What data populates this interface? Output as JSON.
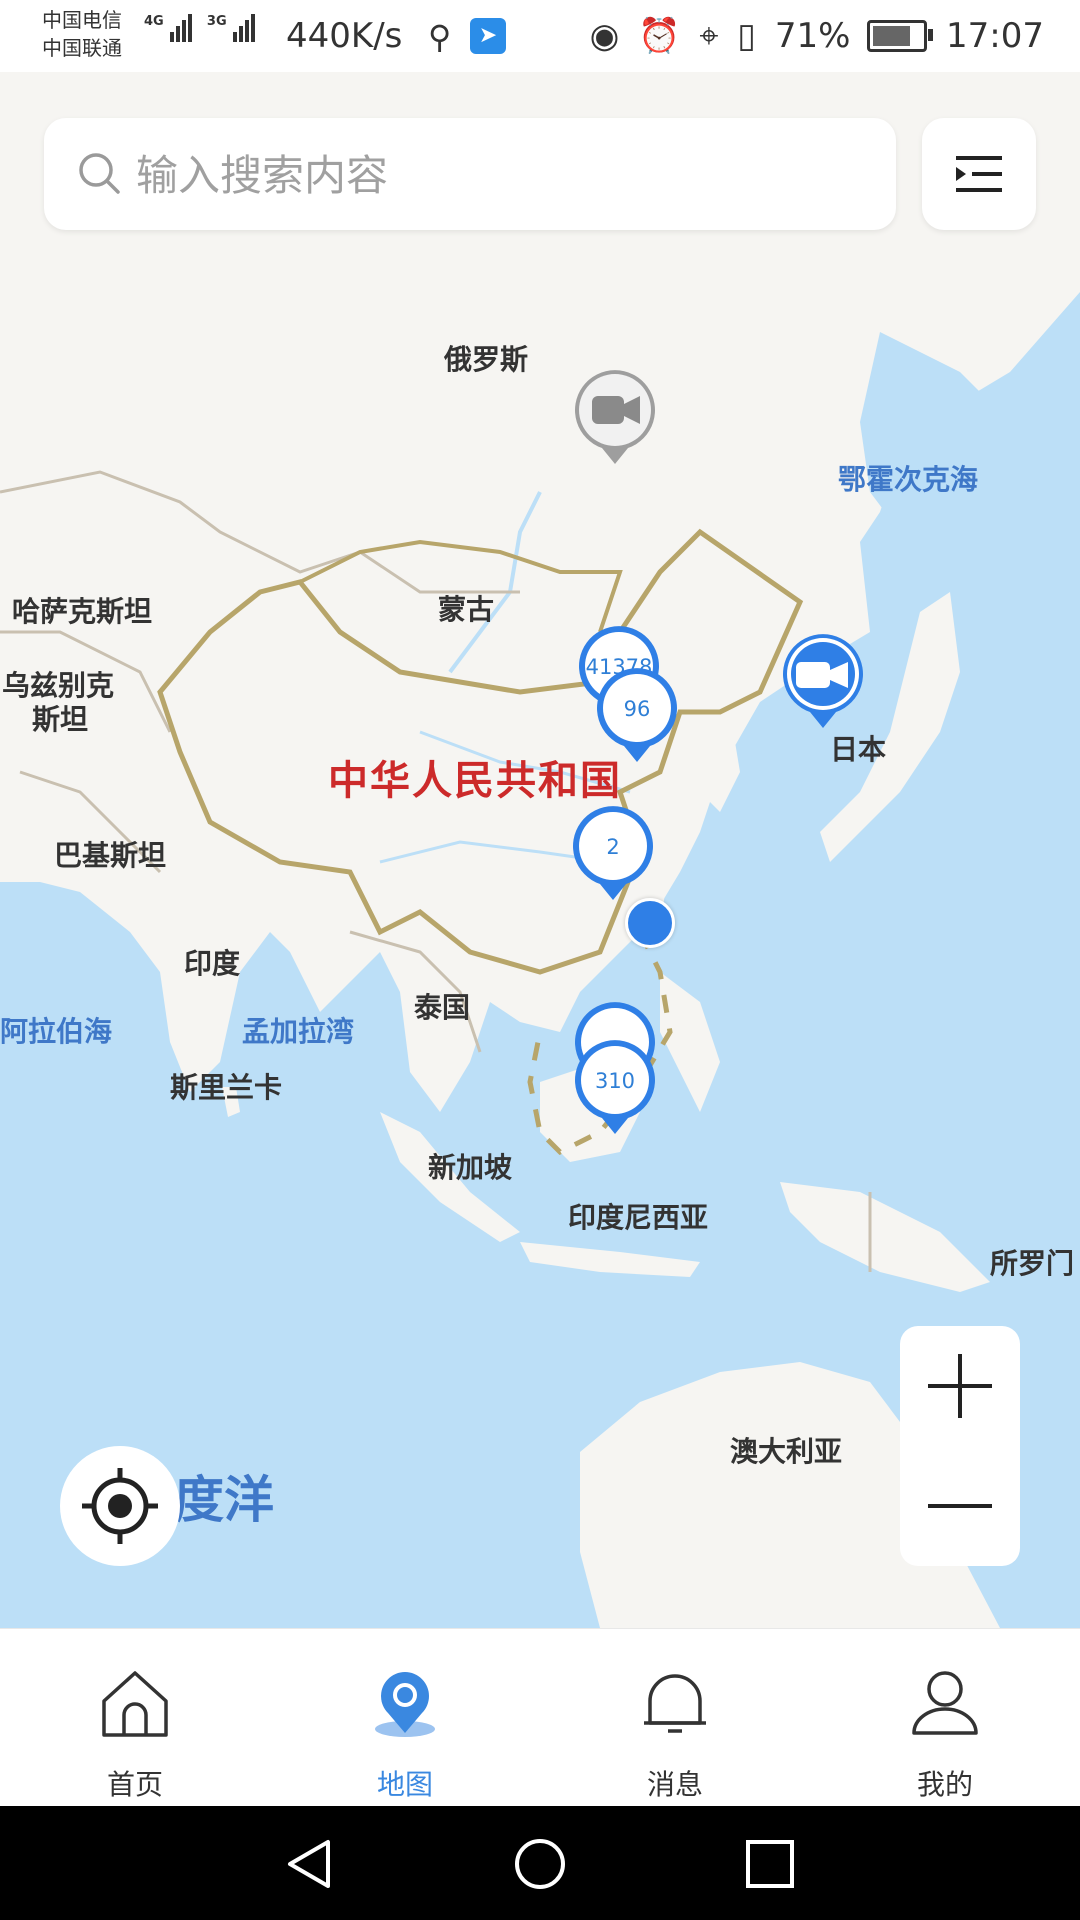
{
  "status_bar": {
    "carrier_1": "中国电信",
    "carrier_2": "中国联通",
    "net_1": "4G",
    "net_2": "3G",
    "speed": "440K/s",
    "battery": "71%",
    "time": "17:07"
  },
  "search": {
    "placeholder": "输入搜索内容"
  },
  "map": {
    "labels": {
      "russia": "俄罗斯",
      "okhotsk": "鄂霍次克海",
      "kazakhstan": "哈萨克斯坦",
      "mongolia": "蒙古",
      "uzbek_1": "乌兹别克",
      "uzbek_2": "斯坦",
      "china": "中华人民共和国",
      "japan": "日本",
      "pakistan": "巴基斯坦",
      "india": "印度",
      "thailand": "泰国",
      "arabian_sea": "阿拉伯海",
      "bengal_bay": "孟加拉湾",
      "sri_lanka": "斯里兰卡",
      "singapore": "新加坡",
      "indonesia": "印度尼西亚",
      "solomon": "所罗门",
      "australia": "澳大利亚",
      "indian_ocean": "度洋"
    },
    "clusters": [
      {
        "count": "41378"
      },
      {
        "count": "96"
      },
      {
        "count": "2"
      },
      {
        "count": ""
      },
      {
        "count": "310"
      }
    ],
    "camera_markers": [
      {
        "icon": "video-camera-icon",
        "color": "#9e9e9e"
      },
      {
        "icon": "video-camera-icon",
        "color": "#2f7fe6"
      }
    ],
    "colors": {
      "sea": "#bcdff7",
      "land": "#f6f5f2",
      "border_main": "#b7a56a",
      "marker_blue": "#2f7fe6"
    }
  },
  "tabs": [
    {
      "label": "首页",
      "icon": "home-icon",
      "active": false
    },
    {
      "label": "地图",
      "icon": "map-pin-icon",
      "active": true
    },
    {
      "label": "消息",
      "icon": "bell-icon",
      "active": false
    },
    {
      "label": "我的",
      "icon": "user-icon",
      "active": false
    }
  ],
  "accent_color": "#3a88e0"
}
